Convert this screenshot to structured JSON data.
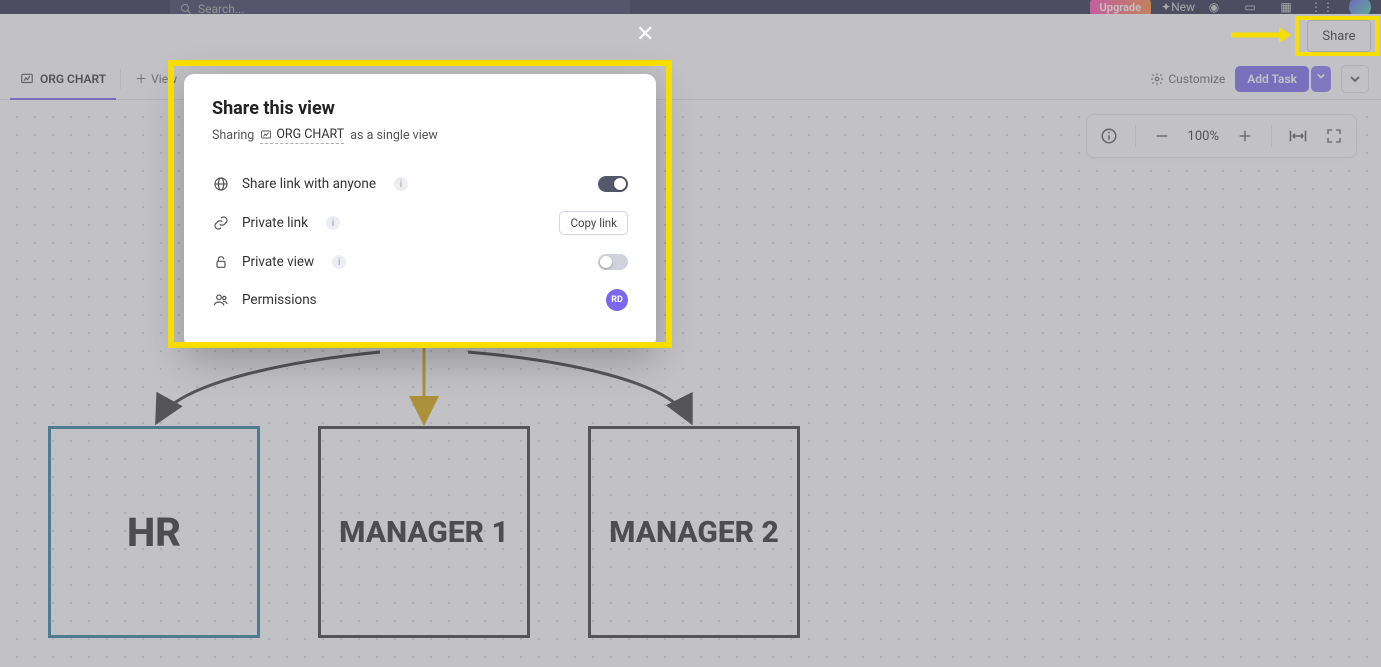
{
  "topbar": {
    "search_placeholder": "Search...",
    "upgrade_label": "Upgrade",
    "new_label": "New"
  },
  "header": {
    "share_label": "Share"
  },
  "tabs": {
    "active_tab": "ORG CHART",
    "add_view_label": "View"
  },
  "toolbar": {
    "customize_label": "Customize",
    "add_task_label": "Add Task"
  },
  "zoom": {
    "percent": "100%"
  },
  "org": {
    "hr": "HR",
    "m1": "MANAGER 1",
    "m2": "MANAGER 2"
  },
  "modal": {
    "title": "Share this view",
    "sub_prefix": "Sharing",
    "sub_chip": "ORG CHART",
    "sub_suffix": "as a single view",
    "rows": {
      "share_anyone": "Share link with anyone",
      "private_link": "Private link",
      "private_view": "Private view",
      "permissions": "Permissions"
    },
    "copy_link_label": "Copy link",
    "perm_initials": "RD"
  }
}
